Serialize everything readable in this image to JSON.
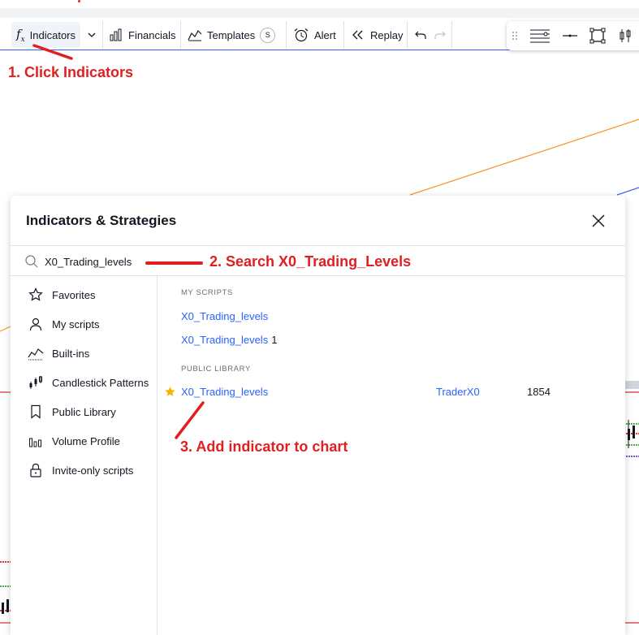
{
  "toolbar": {
    "indicators_label": "Indicators",
    "financials_label": "Financials",
    "templates_label": "Templates",
    "templates_badge": "S",
    "alert_label": "Alert",
    "replay_label": "Replay"
  },
  "annotations": {
    "step1": "1. Click Indicators",
    "step2": "2. Search X0_Trading_Levels",
    "step3": "3. Add indicator to chart",
    "color": "#e02020"
  },
  "dialog": {
    "title": "Indicators & Strategies",
    "search_value": "X0_Trading_levels",
    "sidebar": [
      {
        "label": "Favorites",
        "icon": "star-outline-icon"
      },
      {
        "label": "My scripts",
        "icon": "user-icon"
      },
      {
        "label": "Built-ins",
        "icon": "chart-line-icon"
      },
      {
        "label": "Candlestick Patterns",
        "icon": "candlestick-icon"
      },
      {
        "label": "Public Library",
        "icon": "bookmark-icon"
      },
      {
        "label": "Volume Profile",
        "icon": "volume-profile-icon"
      },
      {
        "label": "Invite-only scripts",
        "icon": "lock-icon"
      }
    ],
    "my_scripts_header": "MY SCRIPTS",
    "my_scripts": [
      {
        "name": "X0_Trading_levels",
        "count": ""
      },
      {
        "name": "X0_Trading_levels",
        "count": "1"
      }
    ],
    "public_library_header": "PUBLIC LIBRARY",
    "public_library": [
      {
        "name": "X0_Trading_levels",
        "author": "TraderX0",
        "likes": "1854",
        "favorited": true
      }
    ]
  },
  "colors": {
    "accent": "#2962ff",
    "text": "#131722",
    "star": "#f5b400",
    "orange_line": "#f7931a",
    "blue_line": "#3d5afe",
    "red_line": "#d32f2f"
  }
}
